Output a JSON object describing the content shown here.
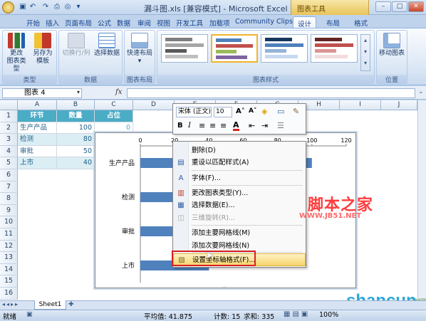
{
  "window": {
    "title": "漏斗图.xls [兼容模式] - Microsoft Excel",
    "context_tab_group": "图表工具"
  },
  "tabs": [
    "开始",
    "插入",
    "页面布局",
    "公式",
    "数据",
    "审阅",
    "视图",
    "开发工具",
    "加载项",
    "Community Clips",
    "设计",
    "布局",
    "格式"
  ],
  "active_tab": "设计",
  "ribbon": {
    "groups": [
      {
        "label": "类型",
        "buttons": [
          "更改\n图表类型",
          "另存为\n模板"
        ]
      },
      {
        "label": "数据",
        "buttons": [
          "切换行/列",
          "选择数据"
        ]
      },
      {
        "label": "图表布局",
        "buttons": [
          "快速布局"
        ]
      },
      {
        "label": "图表样式",
        "buttons": []
      },
      {
        "label": "位置",
        "buttons": [
          "移动图表"
        ]
      }
    ],
    "b1": "更改",
    "b1b": "图表类型",
    "b2": "另存为",
    "b2b": "模板",
    "b3": "切换行/列",
    "b4": "选择数据",
    "b5": "快速布局",
    "b6": "移动图表"
  },
  "formula_bar": {
    "name_box": "图表 4",
    "fx": "fx",
    "value": ""
  },
  "columns": [
    "A",
    "B",
    "C",
    "D",
    "E",
    "F",
    "G",
    "H",
    "I",
    "J"
  ],
  "rows": [
    "1",
    "2",
    "3",
    "4",
    "5",
    "6",
    "7",
    "8",
    "9",
    "10",
    "11",
    "12",
    "13",
    "14",
    "15",
    "16"
  ],
  "table": {
    "headers": [
      "环节",
      "数量",
      "占位"
    ],
    "rows": [
      [
        "生产产品",
        "100",
        "0"
      ],
      [
        "检测",
        "80",
        "10"
      ],
      [
        "审批",
        "50",
        "25"
      ],
      [
        "上市",
        "40",
        "30"
      ]
    ]
  },
  "mini_toolbar": {
    "font": "宋体 (正文)",
    "size": "10"
  },
  "context_menu": {
    "items": [
      {
        "label": "删除(D)",
        "enabled": true
      },
      {
        "label": "重设以匹配样式(A)",
        "enabled": true
      },
      {
        "label": "字体(F)...",
        "enabled": true
      },
      {
        "label": "更改图表类型(Y)...",
        "enabled": true
      },
      {
        "label": "选择数据(E)...",
        "enabled": true
      },
      {
        "label": "三维旋转(R)...",
        "enabled": false
      },
      {
        "label": "添加主要网格线(M)",
        "enabled": true
      },
      {
        "label": "添加次要网格线(N)",
        "enabled": true
      },
      {
        "label": "设置坐标轴格式(F)...",
        "enabled": true,
        "highlighted": true
      }
    ]
  },
  "chart_data": {
    "type": "bar",
    "categories": [
      "生产产品",
      "检测",
      "审批",
      "上市"
    ],
    "series": [
      {
        "values": [
          100,
          80,
          50,
          40
        ]
      }
    ],
    "xlim": [
      0,
      120
    ],
    "x_ticks": [
      "0",
      "20",
      "40",
      "60",
      "80",
      "100",
      "120"
    ],
    "title": "",
    "xlabel": "",
    "ylabel": ""
  },
  "sheet_tab": "Sheet1",
  "status": {
    "mode": "就绪",
    "average": "平均值: 41.875",
    "count": "计数: 15",
    "sum": "求和: 335",
    "zoom": "100%"
  },
  "watermark": {
    "text1": "脚本之家",
    "text2": "WWW.JB51.NET",
    "text3": "shancun",
    "text4": "山村网"
  },
  "colors": {
    "bar": "#4f81bd",
    "header_fill": "#4bacc6",
    "band_fill": "#dbeef3",
    "highlight": "#f7d36b",
    "red_box": "#d62222"
  }
}
